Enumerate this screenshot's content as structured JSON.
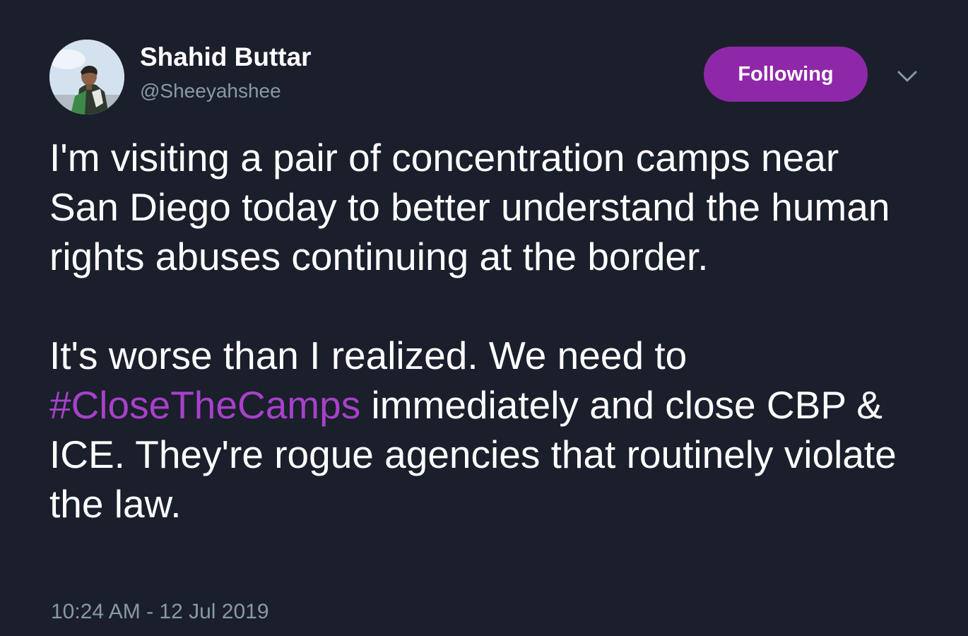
{
  "author": {
    "display_name": "Shahid Buttar",
    "handle": "@Sheeyahshee"
  },
  "actions": {
    "follow_label": "Following",
    "follow_color": "#8f28a8",
    "menu_icon": "chevron-down-icon"
  },
  "tweet": {
    "paragraph1": "I'm visiting a pair of concentration camps near San Diego today to better understand the human rights abuses continuing at the border.",
    "paragraph2_before": "It's worse than I realized. We need to ",
    "hashtag": "#CloseTheCamps",
    "paragraph2_after": " immediately and close CBP & ICE. They're rogue agencies that routinely violate the law.",
    "hashtag_color": "#a741c9"
  },
  "meta": {
    "timestamp": "10:24 AM - 12 Jul 2019"
  },
  "colors": {
    "background": "#1a1f2b",
    "secondary_text": "#8899a6"
  }
}
